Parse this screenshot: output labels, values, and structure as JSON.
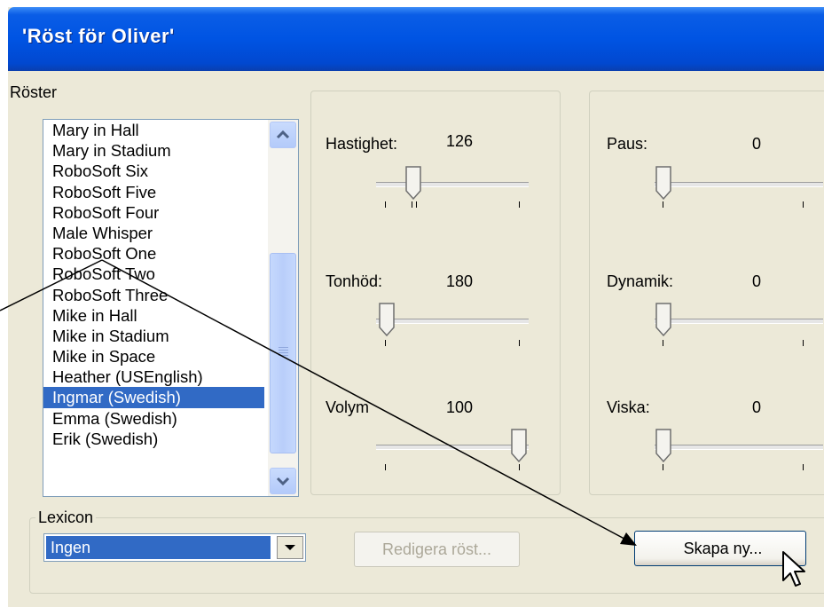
{
  "window": {
    "title": "'Röst för Oliver'"
  },
  "voices": {
    "label": "Röster",
    "items": [
      "Mary in Hall",
      "Mary in Stadium",
      "RoboSoft Six",
      "RoboSoft Five",
      "RoboSoft Four",
      "Male Whisper",
      "RoboSoft One",
      "RoboSoft Two",
      "RoboSoft Three",
      "Mike in Hall",
      "Mike in Stadium",
      "Mike in Space",
      "Heather (USEnglish)",
      "Ingmar (Swedish)",
      "Emma (Swedish)",
      "Erik (Swedish)"
    ],
    "selected": "Ingmar (Swedish)"
  },
  "sliders": {
    "hastighet": {
      "label": "Hastighet:",
      "value": "126"
    },
    "tonhojd": {
      "label": "Tonhöd:",
      "value": "180"
    },
    "volym": {
      "label": "Volym",
      "value": "100"
    },
    "paus": {
      "label": "Paus:",
      "value": "0"
    },
    "dynamik": {
      "label": "Dynamik:",
      "value": "0"
    },
    "viska": {
      "label": "Viska:",
      "value": "0"
    }
  },
  "lexicon": {
    "label": "Lexicon",
    "selected": "Ingen"
  },
  "buttons": {
    "edit_voice": "Redigera röst...",
    "create_new": "Skapa ny..."
  },
  "icons": [
    "scroll-up-icon",
    "scroll-down-icon",
    "dropdown-arrow-icon",
    "mouse-cursor-icon",
    "annotation-arrow-icon"
  ],
  "colors": {
    "selection": "#316ac5",
    "titlebar": "#0054e3",
    "dialog_bg": "#ece9d8"
  }
}
